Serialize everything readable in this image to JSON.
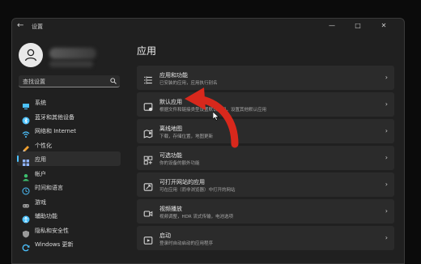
{
  "window": {
    "title": "设置",
    "back_glyph": "←",
    "minimize_glyph": "—",
    "maximize_glyph": "□",
    "close_glyph": "✕"
  },
  "search": {
    "placeholder": "查找设置"
  },
  "nav": {
    "items": [
      {
        "label": "系统",
        "icon": "monitor-icon",
        "color": "#4cc2ff"
      },
      {
        "label": "蓝牙和其他设备",
        "icon": "bluetooth-icon",
        "color": "#4cc2ff"
      },
      {
        "label": "网络和 Internet",
        "icon": "wifi-icon",
        "color": "#4cc2ff"
      },
      {
        "label": "个性化",
        "icon": "brush-icon",
        "color": "#f0a030"
      },
      {
        "label": "应用",
        "icon": "apps-icon",
        "color": "#8fb4ff",
        "selected": true
      },
      {
        "label": "帐户",
        "icon": "person-icon",
        "color": "#3dbf6e"
      },
      {
        "label": "时间和语言",
        "icon": "globe-clock-icon",
        "color": "#4cc2ff"
      },
      {
        "label": "游戏",
        "icon": "gamepad-icon",
        "color": "#9a9a9a"
      },
      {
        "label": "辅助功能",
        "icon": "accessibility-icon",
        "color": "#4cc2ff"
      },
      {
        "label": "隐私和安全性",
        "icon": "shield-icon",
        "color": "#9a9a9a"
      },
      {
        "label": "Windows 更新",
        "icon": "update-icon",
        "color": "#4cc2ff"
      }
    ]
  },
  "main": {
    "title": "应用",
    "cards": [
      {
        "title": "应用和功能",
        "desc": "已安装的应用，应用执行别名",
        "icon": "list-icon"
      },
      {
        "title": "默认应用",
        "desc": "根据文件和链接类型设置默认应用，设置其他默认应用",
        "icon": "default-apps-icon"
      },
      {
        "title": "离线地图",
        "desc": "下载，存储位置，地图更新",
        "icon": "map-icon"
      },
      {
        "title": "可选功能",
        "desc": "你的设备的额外功能",
        "icon": "optional-features-icon"
      },
      {
        "title": "可打开网站的应用",
        "desc": "可在应用（而非浏览器）中打开的网站",
        "icon": "web-app-icon"
      },
      {
        "title": "视频播放",
        "desc": "视频调整，HDR 流式传输，电池选项",
        "icon": "video-icon"
      },
      {
        "title": "启动",
        "desc": "登录时自动启动的应用程序",
        "icon": "startup-icon"
      }
    ],
    "chevron": "›"
  },
  "colors": {
    "accent": "#4cc2ff",
    "annotation_arrow": "#d8281c"
  }
}
